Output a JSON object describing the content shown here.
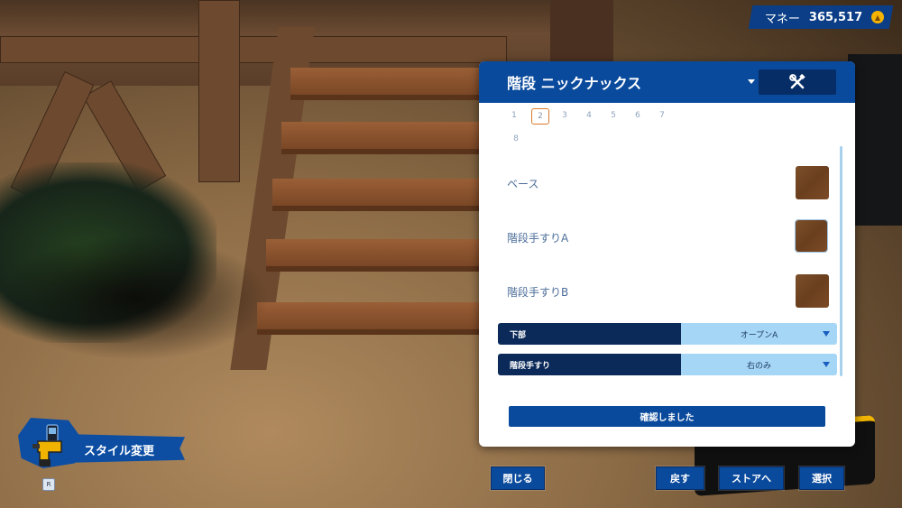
{
  "money": {
    "label": "マネー",
    "value": "365,517"
  },
  "panel": {
    "title": "階段 ニックナックス",
    "pages": [
      "1",
      "2",
      "3",
      "4",
      "5",
      "6",
      "7",
      "8"
    ],
    "active_page": "2",
    "materials": [
      {
        "label": "ベース"
      },
      {
        "label": "階段手すりA"
      },
      {
        "label": "階段手すりB"
      }
    ],
    "selects": [
      {
        "label": "下部",
        "value": "オープンA"
      },
      {
        "label": "階段手すり",
        "value": "右のみ"
      }
    ],
    "confirm_label": "確認しました"
  },
  "style_change": {
    "label": "スタイル変更",
    "key": "R"
  },
  "buttons": {
    "close": "閉じる",
    "back": "戻す",
    "store": "ストアへ",
    "select": "選択"
  },
  "colors": {
    "primary": "#0a4a9c",
    "dark": "#0b2a5a",
    "select_value_bg": "#a6d6f6",
    "active_page_border": "#d97a2b",
    "wood_swatch": "#6a3f1e"
  }
}
